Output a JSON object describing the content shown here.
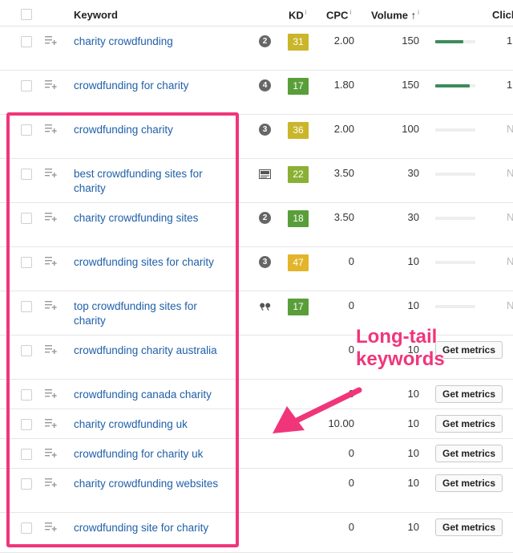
{
  "header": {
    "keyword": "Keyword",
    "kd": "KD",
    "cpc": "CPC",
    "volume": "Volume",
    "clicks": "Clicl",
    "info_mark": "i",
    "sort_arrow": "↑"
  },
  "rows": [
    {
      "keyword": "charity crowdfunding",
      "serp_feature": "2",
      "serp_icon": "number-circle-icon",
      "kd": "31",
      "kd_color": "#c9b62a",
      "cpc": "2.00",
      "volume": "150",
      "traffic_fraction": 0.7,
      "action": "",
      "clicks": "1"
    },
    {
      "keyword": "crowdfunding for charity",
      "serp_feature": "4",
      "serp_icon": "number-circle-icon",
      "kd": "17",
      "kd_color": "#5a9e3a",
      "cpc": "1.80",
      "volume": "150",
      "traffic_fraction": 0.85,
      "action": "",
      "clicks": "1"
    },
    {
      "keyword": "crowdfunding charity",
      "serp_feature": "3",
      "serp_icon": "number-circle-icon",
      "kd": "36",
      "kd_color": "#c9b62a",
      "cpc": "2.00",
      "volume": "100",
      "traffic_fraction": 0,
      "action": "",
      "clicks": "N"
    },
    {
      "keyword": "best crowdfunding sites for charity",
      "serp_feature": "",
      "serp_icon": "ad-icon",
      "kd": "22",
      "kd_color": "#8ab034",
      "cpc": "3.50",
      "volume": "30",
      "traffic_fraction": 0,
      "action": "",
      "clicks": "N"
    },
    {
      "keyword": "charity crowdfunding sites",
      "serp_feature": "2",
      "serp_icon": "number-circle-icon",
      "kd": "18",
      "kd_color": "#5a9e3a",
      "cpc": "3.50",
      "volume": "30",
      "traffic_fraction": 0,
      "action": "",
      "clicks": "N"
    },
    {
      "keyword": "crowdfunding sites for charity",
      "serp_feature": "3",
      "serp_icon": "number-circle-icon",
      "kd": "47",
      "kd_color": "#e3b52b",
      "cpc": "0",
      "volume": "10",
      "traffic_fraction": 0,
      "action": "",
      "clicks": "N"
    },
    {
      "keyword": "top crowdfunding sites for charity",
      "serp_feature": "",
      "serp_icon": "quote-icon",
      "kd": "17",
      "kd_color": "#5a9e3a",
      "cpc": "0",
      "volume": "10",
      "traffic_fraction": 0,
      "action": "",
      "clicks": "N"
    },
    {
      "keyword": "crowdfunding charity australia",
      "serp_feature": "",
      "serp_icon": "",
      "kd": "",
      "kd_color": "",
      "cpc": "0",
      "volume": "10",
      "traffic_fraction": null,
      "action": "Get metrics",
      "clicks": ""
    },
    {
      "keyword": "crowdfunding canada charity",
      "serp_feature": "",
      "serp_icon": "",
      "kd": "",
      "kd_color": "",
      "cpc": "0",
      "volume": "10",
      "traffic_fraction": null,
      "action": "Get metrics",
      "clicks": ""
    },
    {
      "keyword": "charity crowdfunding uk",
      "serp_feature": "",
      "serp_icon": "",
      "kd": "",
      "kd_color": "",
      "cpc": "10.00",
      "volume": "10",
      "traffic_fraction": null,
      "action": "Get metrics",
      "clicks": ""
    },
    {
      "keyword": "crowdfunding for charity uk",
      "serp_feature": "",
      "serp_icon": "",
      "kd": "",
      "kd_color": "",
      "cpc": "0",
      "volume": "10",
      "traffic_fraction": null,
      "action": "Get metrics",
      "clicks": ""
    },
    {
      "keyword": "charity crowdfunding websites",
      "serp_feature": "",
      "serp_icon": "",
      "kd": "",
      "kd_color": "",
      "cpc": "0",
      "volume": "10",
      "traffic_fraction": null,
      "action": "Get metrics",
      "clicks": ""
    },
    {
      "keyword": "crowdfunding site for charity",
      "serp_feature": "",
      "serp_icon": "",
      "kd": "",
      "kd_color": "",
      "cpc": "0",
      "volume": "10",
      "traffic_fraction": null,
      "action": "Get metrics",
      "clicks": ""
    }
  ],
  "annotation": {
    "line1": "Long-tail",
    "line2": "keywords",
    "color": "#f0357a"
  }
}
